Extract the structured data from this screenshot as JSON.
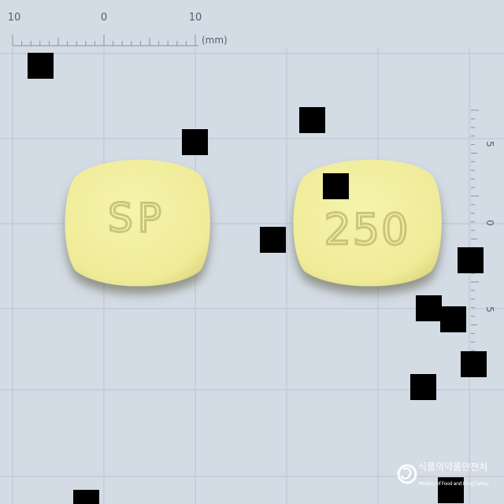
{
  "ruler_top": {
    "labels": [
      "10",
      "0",
      "10"
    ],
    "unit": "(mm)"
  },
  "ruler_right": {
    "labels": [
      "5",
      "0",
      "5"
    ]
  },
  "tablets": [
    {
      "imprint": "SP",
      "color": "#f2f09f"
    },
    {
      "imprint": "250",
      "color": "#f2f09f"
    }
  ],
  "logo": {
    "korean_text": "식품의약품안전처",
    "english_text": "Ministry of Food and Drug Safety"
  },
  "colors": {
    "background": "#d3dbe5",
    "grid": "#b8c4d2",
    "tablet": "#f2f09f",
    "redaction": "#000000"
  }
}
